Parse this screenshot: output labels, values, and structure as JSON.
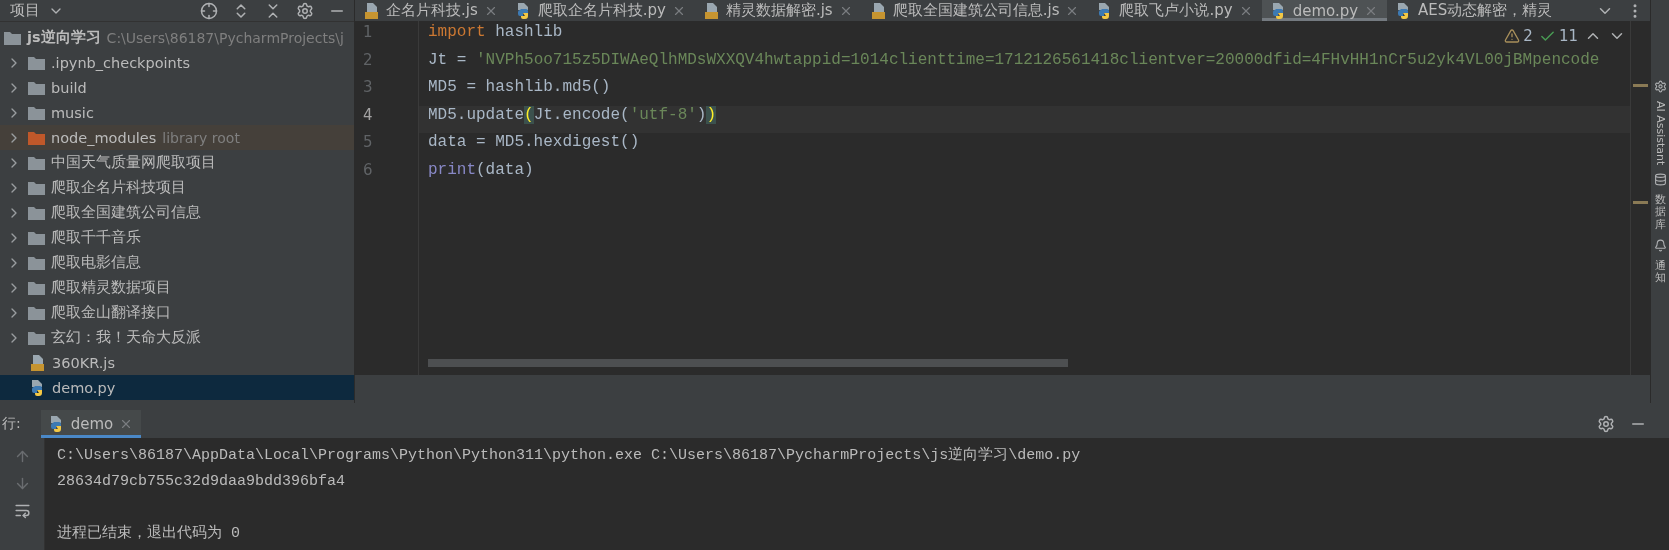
{
  "project_panel": {
    "title": "项目",
    "tree": {
      "name": "js逆向学习",
      "path": "C:\\Users\\86187\\PycharmProjects\\j",
      "children": [
        {
          "name": ".ipynb_checkpoints",
          "kind": "folder",
          "selected": false
        },
        {
          "name": "build",
          "kind": "folder",
          "selected": false
        },
        {
          "name": "music",
          "kind": "folder",
          "selected": false
        },
        {
          "name": "node_modules",
          "kind": "library",
          "hint": "library root",
          "selected": false
        },
        {
          "name": "中国天气质量网爬取项目",
          "kind": "folder",
          "selected": false
        },
        {
          "name": "爬取企名片科技项目",
          "kind": "folder",
          "selected": false
        },
        {
          "name": "爬取全国建筑公司信息",
          "kind": "folder",
          "selected": false
        },
        {
          "name": "爬取千千音乐",
          "kind": "folder",
          "selected": false
        },
        {
          "name": "爬取电影信息",
          "kind": "folder",
          "selected": false
        },
        {
          "name": "爬取精灵数据项目",
          "kind": "folder",
          "selected": false
        },
        {
          "name": "爬取金山翻译接口",
          "kind": "folder",
          "selected": false
        },
        {
          "name": "玄幻：我！天命大反派",
          "kind": "folder",
          "selected": false
        },
        {
          "name": "360KR.js",
          "kind": "js",
          "selected": false
        },
        {
          "name": "demo.py",
          "kind": "py",
          "selected": true
        }
      ]
    }
  },
  "editor_tabs": [
    {
      "label": "企名片科技.js",
      "kind": "js",
      "selected": false,
      "closable": true
    },
    {
      "label": "爬取企名片科技.py",
      "kind": "py",
      "selected": false,
      "closable": true
    },
    {
      "label": "精灵数据解密.js",
      "kind": "js",
      "selected": false,
      "closable": true
    },
    {
      "label": "爬取全国建筑公司信息.js",
      "kind": "js",
      "selected": false,
      "closable": true
    },
    {
      "label": "爬取飞卢小说.py",
      "kind": "py",
      "selected": false,
      "closable": true
    },
    {
      "label": "demo.py",
      "kind": "py",
      "selected": true,
      "closable": true
    },
    {
      "label": "AES动态解密，精灵",
      "kind": "py",
      "selected": false,
      "closable": false
    }
  ],
  "editor": {
    "inspections": {
      "warnings": "2",
      "weak_warnings": "11"
    },
    "lines": [
      {
        "number": "1",
        "current": false,
        "tokens": [
          {
            "text": "import",
            "kind": "keyword"
          },
          {
            "text": " hashlib",
            "kind": "plain"
          }
        ]
      },
      {
        "number": "2",
        "current": false,
        "tokens": [
          {
            "text": "Jt = ",
            "kind": "plain"
          },
          {
            "text": "'NVPh5oo715z5DIWAeQlhMDsWXXQV4hwtappid=1014clienttime=1712126561418clientver=20000dfid=4FHvHH1nCr5u2yk4VL00jBMpencode",
            "kind": "string"
          }
        ]
      },
      {
        "number": "3",
        "current": false,
        "tokens": [
          {
            "text": "MD5 = hashlib.md5()",
            "kind": "plain"
          }
        ]
      },
      {
        "number": "4",
        "current": true,
        "tokens": [
          {
            "text": "MD5.update",
            "kind": "plain"
          },
          {
            "text": "(",
            "kind": "match"
          },
          {
            "text": "Jt.encode(",
            "kind": "plain"
          },
          {
            "text": "'utf-8'",
            "kind": "string"
          },
          {
            "text": ")",
            "kind": "plain"
          },
          {
            "text": ")",
            "kind": "match"
          }
        ]
      },
      {
        "number": "5",
        "current": false,
        "tokens": [
          {
            "text": "data = MD5.hexdigest()",
            "kind": "plain"
          }
        ]
      },
      {
        "number": "6",
        "current": false,
        "tokens": [
          {
            "text": "print",
            "kind": "builtin"
          },
          {
            "text": "(data)",
            "kind": "plain"
          }
        ]
      }
    ]
  },
  "right_strip": [
    {
      "label": "AI Assistant",
      "kind": "latin"
    },
    {
      "label": "数据库",
      "kind": "cjk"
    },
    {
      "label": "通知",
      "kind": "cjk"
    }
  ],
  "run_panel": {
    "label": "行:",
    "tabs": [
      {
        "label": "demo",
        "selected": true
      }
    ],
    "command": "C:\\Users\\86187\\AppData\\Local\\Programs\\Python\\Python311\\python.exe C:\\Users\\86187\\PycharmProjects\\js逆向学习\\demo.py",
    "output": "28634d79cb755c32d9daa9bdd396bfa4",
    "exit_message": "进程已结束，退出代码为 0"
  }
}
